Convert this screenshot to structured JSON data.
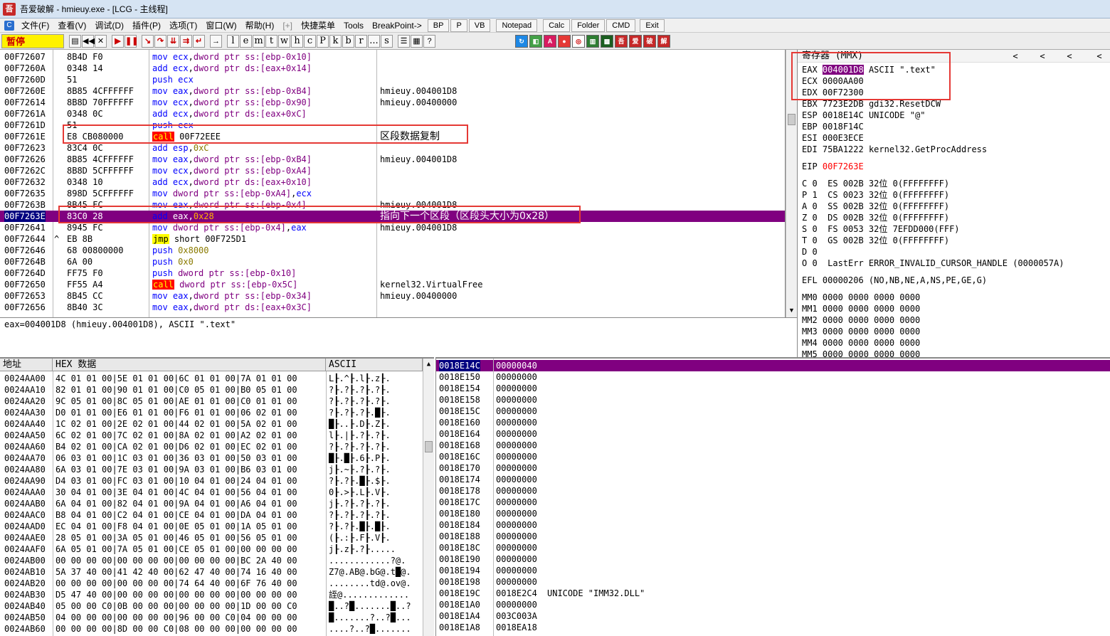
{
  "window": {
    "title": "吾爱破解 - hmieuy.exe - [LCG - 主线程]"
  },
  "menu": {
    "items": [
      "文件(F)",
      "查看(V)",
      "调试(D)",
      "插件(P)",
      "选项(T)",
      "窗口(W)",
      "帮助(H)",
      "[+]",
      "快捷菜单",
      "Tools",
      "BreakPoint->"
    ],
    "buttons": [
      "BP",
      "P",
      "VB",
      "Notepad",
      "Calc",
      "Folder",
      "CMD",
      "Exit"
    ]
  },
  "toolbar": {
    "status": "暂停",
    "letters": [
      "l",
      "e",
      "m",
      "t",
      "w",
      "h",
      "c",
      "P",
      "k",
      "b",
      "r",
      "...",
      "s"
    ]
  },
  "disasm": {
    "rows": [
      {
        "addr": "00F72607",
        "hex": "8B4D F0",
        "mn": "mov",
        "ops": [
          [
            "reg",
            "ecx"
          ],
          [
            "plain",
            ","
          ],
          [
            "mem",
            "dword ptr ss:[ebp-0x10]"
          ]
        ],
        "cm": ""
      },
      {
        "addr": "00F7260A",
        "hex": "0348 14",
        "mn": "add",
        "ops": [
          [
            "reg",
            "ecx"
          ],
          [
            "plain",
            ","
          ],
          [
            "mem",
            "dword ptr ds:[eax+0x14]"
          ]
        ],
        "cm": ""
      },
      {
        "addr": "00F7260D",
        "hex": "51",
        "mn": "push",
        "ops": [
          [
            "reg",
            "ecx"
          ]
        ],
        "cm": ""
      },
      {
        "addr": "00F7260E",
        "hex": "8B85 4CFFFFFF",
        "mn": "mov",
        "ops": [
          [
            "reg",
            "eax"
          ],
          [
            "plain",
            ","
          ],
          [
            "mem",
            "dword ptr ss:[ebp-0xB4]"
          ]
        ],
        "cm": "hmieuy.004001D8"
      },
      {
        "addr": "00F72614",
        "hex": "8B8D 70FFFFFF",
        "mn": "mov",
        "ops": [
          [
            "reg",
            "ecx"
          ],
          [
            "plain",
            ","
          ],
          [
            "mem",
            "dword ptr ss:[ebp-0x90]"
          ]
        ],
        "cm": "hmieuy.00400000"
      },
      {
        "addr": "00F7261A",
        "hex": "0348 0C",
        "mn": "add",
        "ops": [
          [
            "reg",
            "ecx"
          ],
          [
            "plain",
            ","
          ],
          [
            "mem",
            "dword ptr ds:[eax+0xC]"
          ]
        ],
        "cm": ""
      },
      {
        "addr": "00F7261D",
        "hex": "51",
        "mn": "push",
        "ops": [
          [
            "reg",
            "ecx"
          ]
        ],
        "cm": ""
      },
      {
        "addr": "00F7261E",
        "hex": "E8 CB080000",
        "mn": "call",
        "ops": [
          [
            "plain",
            "00F72EEE"
          ]
        ],
        "cm": "区段数据复制"
      },
      {
        "addr": "00F72623",
        "hex": "83C4 0C",
        "mn": "add",
        "ops": [
          [
            "reg",
            "esp"
          ],
          [
            "plain",
            ","
          ],
          [
            "imm",
            "0xC"
          ]
        ],
        "cm": ""
      },
      {
        "addr": "00F72626",
        "hex": "8B85 4CFFFFFF",
        "mn": "mov",
        "ops": [
          [
            "reg",
            "eax"
          ],
          [
            "plain",
            ","
          ],
          [
            "mem",
            "dword ptr ss:[ebp-0xB4]"
          ]
        ],
        "cm": "hmieuy.004001D8"
      },
      {
        "addr": "00F7262C",
        "hex": "8B8D 5CFFFFFF",
        "mn": "mov",
        "ops": [
          [
            "reg",
            "ecx"
          ],
          [
            "plain",
            ","
          ],
          [
            "mem",
            "dword ptr ss:[ebp-0xA4]"
          ]
        ],
        "cm": ""
      },
      {
        "addr": "00F72632",
        "hex": "0348 10",
        "mn": "add",
        "ops": [
          [
            "reg",
            "ecx"
          ],
          [
            "plain",
            ","
          ],
          [
            "mem",
            "dword ptr ds:[eax+0x10]"
          ]
        ],
        "cm": ""
      },
      {
        "addr": "00F72635",
        "hex": "898D 5CFFFFFF",
        "mn": "mov",
        "ops": [
          [
            "mem",
            "dword ptr ss:[ebp-0xA4]"
          ],
          [
            "plain",
            ","
          ],
          [
            "reg",
            "ecx"
          ]
        ],
        "cm": ""
      },
      {
        "addr": "00F7263B",
        "hex": "8B45 FC",
        "mn": "mov",
        "ops": [
          [
            "reg",
            "eax"
          ],
          [
            "plain",
            ","
          ],
          [
            "mem",
            "dword ptr ss:[ebp-0x4]"
          ]
        ],
        "cm": "hmieuy.004001D8"
      },
      {
        "addr": "00F7263E",
        "hex": "83C0 28",
        "mn": "add",
        "ops": [
          [
            "reg",
            "eax"
          ],
          [
            "plain",
            ","
          ],
          [
            "imm",
            "0x28"
          ]
        ],
        "cm": "指向下一个区段（区段头大小为0x28）",
        "sel": true
      },
      {
        "addr": "00F72641",
        "hex": "8945 FC",
        "mn": "mov",
        "ops": [
          [
            "mem",
            "dword ptr ss:[ebp-0x4]"
          ],
          [
            "plain",
            ","
          ],
          [
            "reg",
            "eax"
          ]
        ],
        "cm": "hmieuy.004001D8"
      },
      {
        "addr": "00F72644",
        "hex": "EB 8B",
        "mn": "jmp",
        "ops": [
          [
            "plain",
            "short 00F725D1"
          ]
        ],
        "cm": "",
        "mark": "^"
      },
      {
        "addr": "00F72646",
        "hex": "68 00800000",
        "mn": "push",
        "ops": [
          [
            "imm",
            "0x8000"
          ]
        ],
        "cm": ""
      },
      {
        "addr": "00F7264B",
        "hex": "6A 00",
        "mn": "push",
        "ops": [
          [
            "imm",
            "0x0"
          ]
        ],
        "cm": ""
      },
      {
        "addr": "00F7264D",
        "hex": "FF75 F0",
        "mn": "push",
        "ops": [
          [
            "mem",
            "dword ptr ss:[ebp-0x10]"
          ]
        ],
        "cm": ""
      },
      {
        "addr": "00F72650",
        "hex": "FF55 A4",
        "mn": "call",
        "ops": [
          [
            "mem",
            "dword ptr ss:[ebp-0x5C]"
          ]
        ],
        "cm": "kernel32.VirtualFree"
      },
      {
        "addr": "00F72653",
        "hex": "8B45 CC",
        "mn": "mov",
        "ops": [
          [
            "reg",
            "eax"
          ],
          [
            "plain",
            ","
          ],
          [
            "mem",
            "dword ptr ss:[ebp-0x34]"
          ]
        ],
        "cm": "hmieuy.00400000"
      },
      {
        "addr": "00F72656",
        "hex": "8B40 3C",
        "mn": "mov",
        "ops": [
          [
            "reg",
            "eax"
          ],
          [
            "plain",
            ","
          ],
          [
            "mem",
            "dword ptr ds:[eax+0x3C]"
          ]
        ],
        "cm": ""
      }
    ],
    "info": "eax=004001D8 (hmieuy.004001D8), ASCII \".text\""
  },
  "registers": {
    "header": "寄存器 (MMX)",
    "arrows": [
      "<",
      "<",
      "<",
      "<"
    ],
    "gp": [
      {
        "name": "EAX",
        "val": "004001D8",
        "cm": "ASCII \".text\"",
        "hl": true
      },
      {
        "name": "ECX",
        "val": "0000AA00",
        "cm": ""
      },
      {
        "name": "EDX",
        "val": "00F72300",
        "cm": ""
      },
      {
        "name": "EBX",
        "val": "7723E2DB",
        "cm": "gdi32.ResetDCW"
      },
      {
        "name": "ESP",
        "val": "0018E14C",
        "cm": "UNICODE \"@\""
      },
      {
        "name": "EBP",
        "val": "0018F14C",
        "cm": ""
      },
      {
        "name": "ESI",
        "val": "000E3ECE",
        "cm": ""
      },
      {
        "name": "EDI",
        "val": "75BA1222",
        "cm": "kernel32.GetProcAddress"
      }
    ],
    "eip": {
      "name": "EIP",
      "val": "00F7263E"
    },
    "flags": [
      "C 0  ES 002B 32位 0(FFFFFFFF)",
      "P 1  CS 0023 32位 0(FFFFFFFF)",
      "A 0  SS 002B 32位 0(FFFFFFFF)",
      "Z 0  DS 002B 32位 0(FFFFFFFF)",
      "S 0  FS 0053 32位 7EFDD000(FFF)",
      "T 0  GS 002B 32位 0(FFFFFFFF)",
      "D 0",
      "O 0  LastErr ERROR_INVALID_CURSOR_HANDLE (0000057A)"
    ],
    "efl": "EFL 00000206 (NO,NB,NE,A,NS,PE,GE,G)",
    "mmx": [
      "MM0 0000 0000 0000 0000",
      "MM1 0000 0000 0000 0000",
      "MM2 0000 0000 0000 0000",
      "MM3 0000 0000 0000 0000",
      "MM4 0000 0000 0000 0000",
      "MM5 0000 0000 0000 0000"
    ]
  },
  "dump": {
    "headers": [
      "地址",
      "HEX 数据",
      "ASCII"
    ],
    "rows": [
      {
        "addr": "0024AA00",
        "hex": "4C 01 01 00|5E 01 01 00|6C 01 01 00|7A 01 01 00",
        "asc": "L┠.^┠.l┠.z┠."
      },
      {
        "addr": "0024AA10",
        "hex": "82 01 01 00|90 01 01 00|C0 05 01 00|B0 05 01 00",
        "asc": "?┠.?┠.?┠.?┠."
      },
      {
        "addr": "0024AA20",
        "hex": "9C 05 01 00|8C 05 01 00|AE 01 01 00|C0 01 01 00",
        "asc": "?┠.?┠.?┠.?┠."
      },
      {
        "addr": "0024AA30",
        "hex": "D0 01 01 00|E6 01 01 00|F6 01 01 00|06 02 01 00",
        "asc": "?┠.?┠.?┠.█┠."
      },
      {
        "addr": "0024AA40",
        "hex": "1C 02 01 00|2E 02 01 00|44 02 01 00|5A 02 01 00",
        "asc": "█┠..┠.D┠.Z┠."
      },
      {
        "addr": "0024AA50",
        "hex": "6C 02 01 00|7C 02 01 00|8A 02 01 00|A2 02 01 00",
        "asc": "l┠.|┠.?┠.?┠."
      },
      {
        "addr": "0024AA60",
        "hex": "B4 02 01 00|CA 02 01 00|D6 02 01 00|EC 02 01 00",
        "asc": "?┠.?┠.?┠.?┠."
      },
      {
        "addr": "0024AA70",
        "hex": "06 03 01 00|1C 03 01 00|36 03 01 00|50 03 01 00",
        "asc": "█┠.█┠.6┠.P┠."
      },
      {
        "addr": "0024AA80",
        "hex": "6A 03 01 00|7E 03 01 00|9A 03 01 00|B6 03 01 00",
        "asc": "j┠.~┠.?┠.?┠."
      },
      {
        "addr": "0024AA90",
        "hex": "D4 03 01 00|FC 03 01 00|10 04 01 00|24 04 01 00",
        "asc": "?┠.?┠.█┠.$┠."
      },
      {
        "addr": "0024AAA0",
        "hex": "30 04 01 00|3E 04 01 00|4C 04 01 00|56 04 01 00",
        "asc": "0┠.>┠.L┠.V┠."
      },
      {
        "addr": "0024AAB0",
        "hex": "6A 04 01 00|82 04 01 00|9A 04 01 00|A6 04 01 00",
        "asc": "j┠.?┠.?┠.?┠."
      },
      {
        "addr": "0024AAC0",
        "hex": "B8 04 01 00|C2 04 01 00|CE 04 01 00|DA 04 01 00",
        "asc": "?┠.?┠.?┠.?┠."
      },
      {
        "addr": "0024AAD0",
        "hex": "EC 04 01 00|F8 04 01 00|0E 05 01 00|1A 05 01 00",
        "asc": "?┠.?┠.█┠.█┠."
      },
      {
        "addr": "0024AAE0",
        "hex": "28 05 01 00|3A 05 01 00|46 05 01 00|56 05 01 00",
        "asc": "(┠.:┠.F┠.V┠."
      },
      {
        "addr": "0024AAF0",
        "hex": "6A 05 01 00|7A 05 01 00|CE 05 01 00|00 00 00 00",
        "asc": "j┠.z┠.?┠....."
      },
      {
        "addr": "0024AB00",
        "hex": "00 00 00 00|00 00 00 00|00 00 00 00|BC 2A 40 00",
        "asc": "............?@."
      },
      {
        "addr": "0024AB10",
        "hex": "5A 37 40 00|41 42 40 00|62 47 40 00|74 16 40 00",
        "asc": "Z7@.AB@.bG@.t█@."
      },
      {
        "addr": "0024AB20",
        "hex": "00 00 00 00|00 00 00 00|74 64 40 00|6F 76 40 00",
        "asc": "........td@.ov@."
      },
      {
        "addr": "0024AB30",
        "hex": "D5 47 40 00|00 00 00 00|00 00 00 00|00 00 00 00",
        "asc": "誈@............."
      },
      {
        "addr": "0024AB40",
        "hex": "05 00 00 C0|0B 00 00 00|00 00 00 00|1D 00 00 C0",
        "asc": "█..?█.......█..?"
      },
      {
        "addr": "0024AB50",
        "hex": "04 00 00 00|00 00 00 00|96 00 00 C0|04 00 00 00",
        "asc": "█.......?..?█..."
      },
      {
        "addr": "0024AB60",
        "hex": "00 00 00 00|8D 00 00 C0|08 00 00 00|00 00 00 00",
        "asc": "....?..?█......."
      }
    ]
  },
  "stack": {
    "rows": [
      {
        "addr": "0018E14C",
        "val": "00000040",
        "cm": "",
        "sel": true
      },
      {
        "addr": "0018E150",
        "val": "00000000",
        "cm": ""
      },
      {
        "addr": "0018E154",
        "val": "00000000",
        "cm": ""
      },
      {
        "addr": "0018E158",
        "val": "00000000",
        "cm": ""
      },
      {
        "addr": "0018E15C",
        "val": "00000000",
        "cm": ""
      },
      {
        "addr": "0018E160",
        "val": "00000000",
        "cm": ""
      },
      {
        "addr": "0018E164",
        "val": "00000000",
        "cm": ""
      },
      {
        "addr": "0018E168",
        "val": "00000000",
        "cm": ""
      },
      {
        "addr": "0018E16C",
        "val": "00000000",
        "cm": ""
      },
      {
        "addr": "0018E170",
        "val": "00000000",
        "cm": ""
      },
      {
        "addr": "0018E174",
        "val": "00000000",
        "cm": ""
      },
      {
        "addr": "0018E178",
        "val": "00000000",
        "cm": ""
      },
      {
        "addr": "0018E17C",
        "val": "00000000",
        "cm": ""
      },
      {
        "addr": "0018E180",
        "val": "00000000",
        "cm": ""
      },
      {
        "addr": "0018E184",
        "val": "00000000",
        "cm": ""
      },
      {
        "addr": "0018E188",
        "val": "00000000",
        "cm": ""
      },
      {
        "addr": "0018E18C",
        "val": "00000000",
        "cm": ""
      },
      {
        "addr": "0018E190",
        "val": "00000000",
        "cm": ""
      },
      {
        "addr": "0018E194",
        "val": "00000000",
        "cm": ""
      },
      {
        "addr": "0018E198",
        "val": "00000000",
        "cm": ""
      },
      {
        "addr": "0018E19C",
        "val": "0018E2C4",
        "cm": "UNICODE \"IMM32.DLL\""
      },
      {
        "addr": "0018E1A0",
        "val": "00000000",
        "cm": ""
      },
      {
        "addr": "0018E1A4",
        "val": "003C003A",
        "cm": ""
      },
      {
        "addr": "0018E1A8",
        "val": "0018EA18",
        "cm": ""
      }
    ]
  },
  "colors": {
    "selection": "#800080",
    "annotation": "#e53935",
    "call_bg": "#ff0000",
    "jmp_bg": "#ffff00",
    "status_bg": "#fff200"
  }
}
